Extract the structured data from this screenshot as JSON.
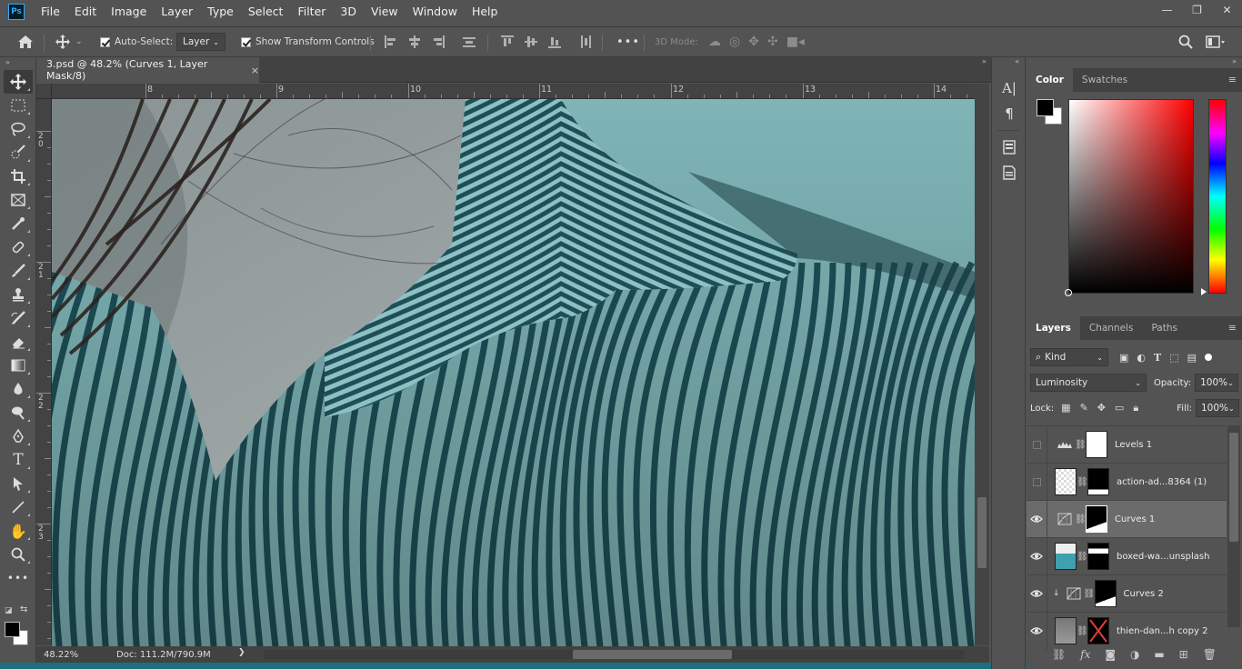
{
  "app": {
    "logo": "Ps"
  },
  "menu": [
    "File",
    "Edit",
    "Image",
    "Layer",
    "Type",
    "Select",
    "Filter",
    "3D",
    "View",
    "Window",
    "Help"
  ],
  "window_controls": {
    "minimize": "—",
    "restore": "❐",
    "close": "✕"
  },
  "options": {
    "auto_select_label": "Auto-Select:",
    "auto_select_target": "Layer",
    "show_transform_label": "Show Transform Controls",
    "more": "•••",
    "mode_3d_label": "3D Mode:"
  },
  "document": {
    "tab_title": "3.psd @ 48.2% (Curves 1, Layer Mask/8)",
    "close": "×"
  },
  "ruler": {
    "top_labels": [
      "8",
      "9",
      "10",
      "11",
      "12",
      "13",
      "14"
    ],
    "left_labels": [
      "2\n0",
      "2\n1",
      "2\n2",
      "2\n3"
    ]
  },
  "status": {
    "zoom": "48.22%",
    "doc": "Doc: 111.2M/790.9M",
    "arrow": "❯"
  },
  "right_col_icons": [
    "character-icon",
    "paragraph-icon",
    "properties-icon",
    "libraries-icon"
  ],
  "color_panel": {
    "tabs": [
      "Color",
      "Swatches"
    ],
    "active_tab": "Color",
    "foreground": "#000000",
    "background": "#ffffff"
  },
  "layers_panel": {
    "tabs": [
      "Layers",
      "Channels",
      "Paths"
    ],
    "active_tab": "Layers",
    "filter_kind": "Kind",
    "blend_mode": "Luminosity",
    "opacity_label": "Opacity:",
    "opacity": "100%",
    "lock_label": "Lock:",
    "fill_label": "Fill:",
    "fill": "100%",
    "layers": [
      {
        "name": "Levels 1",
        "visible": false,
        "type": "adjustment",
        "selected": false
      },
      {
        "name": "action-ad...8364 (1)",
        "visible": false,
        "type": "image",
        "selected": false
      },
      {
        "name": "Curves 1",
        "visible": true,
        "type": "adjustment",
        "selected": true
      },
      {
        "name": "boxed-wa...unsplash",
        "visible": true,
        "type": "image",
        "selected": false
      },
      {
        "name": "Curves 2",
        "visible": true,
        "type": "adjustment",
        "selected": false
      },
      {
        "name": "thien-dan...h copy 2",
        "visible": true,
        "type": "image",
        "selected": false
      }
    ],
    "bottom_icons": [
      "link-icon",
      "fx-icon",
      "mask-icon",
      "adjustment-icon",
      "group-icon",
      "new-layer-icon",
      "trash-icon"
    ]
  },
  "colors": {
    "accent": "#31a8ff",
    "shirt": "#5f9aa0",
    "stripe": "#1e4f58"
  }
}
